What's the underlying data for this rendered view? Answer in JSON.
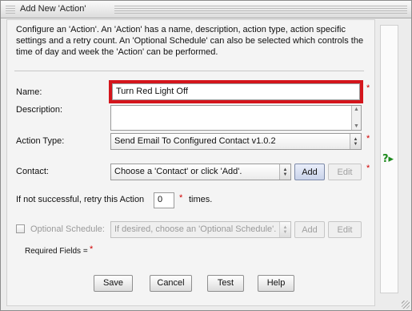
{
  "window": {
    "title": "Add New 'Action'"
  },
  "intro": "Configure an 'Action'. An 'Action' has a name, description, action type, action specific settings and a retry count. An 'Optional Schedule' can also be selected which controls the time of day and week the 'Action' can be performed.",
  "form": {
    "name_label": "Name:",
    "name_value": "Turn Red Light Off",
    "description_label": "Description:",
    "description_value": "",
    "action_type_label": "Action Type:",
    "action_type_value": "Send Email To Configured Contact v1.0.2",
    "contact_label": "Contact:",
    "contact_value": "Choose a 'Contact' or click 'Add'.",
    "contact_add": "Add",
    "contact_edit": "Edit",
    "retry_prefix": "If not successful, retry this Action",
    "retry_value": "0",
    "retry_suffix": "times.",
    "schedule_label": "Optional Schedule:",
    "schedule_value": "If desired, choose an 'Optional Schedule'.",
    "schedule_add": "Add",
    "schedule_edit": "Edit",
    "required_note": "Required Fields =",
    "required_marker": "*"
  },
  "buttons": {
    "save": "Save",
    "cancel": "Cancel",
    "test": "Test",
    "help": "Help"
  },
  "sidebar": {
    "help_icon": "?▸"
  },
  "colors": {
    "highlight": "#d4151c",
    "required": "#d00000",
    "help": "#1d8a1d"
  }
}
